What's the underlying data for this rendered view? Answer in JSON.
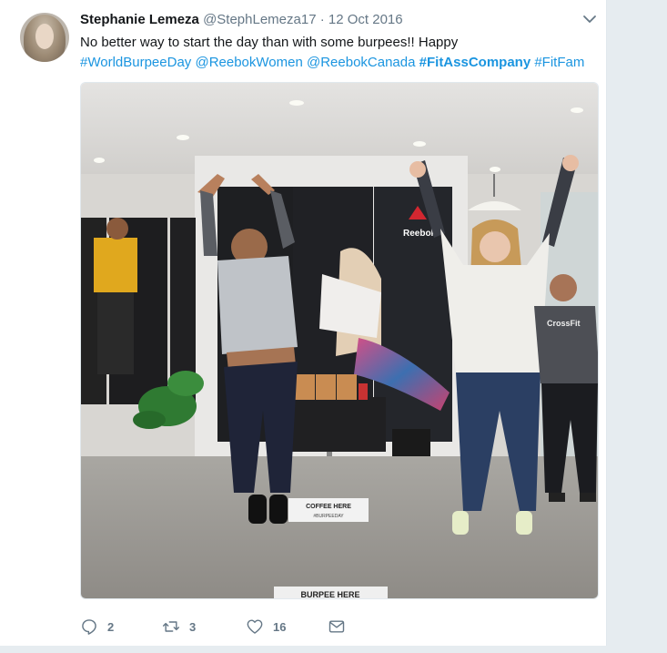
{
  "tweet": {
    "author_name": "Stephanie Lemeza",
    "handle": "@StephLemeza17",
    "separator": "·",
    "date": "12 Oct 2016",
    "text_line1": "No better way to start the day than with some burpees!! Happy",
    "hashtags": [
      {
        "text": "#WorldBurpeeDay",
        "bold": false
      },
      {
        "text": "@ReebokWomen",
        "bold": false
      },
      {
        "text": "@ReebokCanada",
        "bold": false
      },
      {
        "text": "#FitAssCompany",
        "bold": true
      },
      {
        "text": "#FitFam",
        "bold": false
      }
    ],
    "menu_icon": "chevron-down-icon"
  },
  "photo": {
    "logo_text": "Reebok",
    "shirt_text": "CrossFit",
    "sign_coffee": "COFFEE HERE",
    "sign_coffee_sub": "#BURPEEDAY",
    "sign_burpee": "BURPEE HERE"
  },
  "actions": {
    "reply_count": "2",
    "retweet_count": "3",
    "like_count": "16"
  },
  "colors": {
    "link": "#1b95e0",
    "muted": "#657786",
    "background": "#e6ecf0"
  }
}
